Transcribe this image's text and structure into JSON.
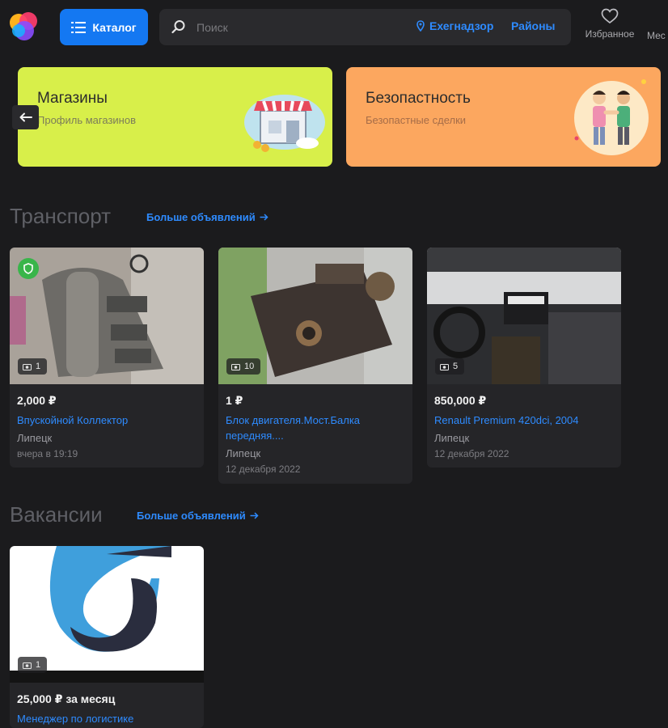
{
  "header": {
    "catalog_label": "Каталог",
    "search_placeholder": "Поиск",
    "location": "Ехегнадзор",
    "districts": "Районы",
    "favorites": "Избранное",
    "messages": "Мес"
  },
  "banners": [
    {
      "title": "Магазины",
      "subtitle": "Профиль магазинов"
    },
    {
      "title": "Безопастность",
      "subtitle": "Безопастные сделки"
    }
  ],
  "transport": {
    "title": "Транспорт",
    "more": "Больше объявлений",
    "cards": [
      {
        "photos": "1",
        "price": "2,000 ₽",
        "title": "Впускойной Коллектор",
        "city": "Липецк",
        "date": "вчера в 19:19",
        "verified": true
      },
      {
        "photos": "10",
        "price": "1 ₽",
        "title": "Блок двигателя.Мост.Балка передняя....",
        "city": "Липецк",
        "date": "12 декабря 2022",
        "verified": false
      },
      {
        "photos": "5",
        "price": "850,000 ₽",
        "title": "Renault Premium 420dci, 2004",
        "city": "Липецк",
        "date": "12 декабря 2022",
        "verified": false
      }
    ]
  },
  "vacancies": {
    "title": "Вакансии",
    "more": "Больше объявлений",
    "cards": [
      {
        "photos": "1",
        "price": "25,000 ₽ за месяц",
        "title": "Менеджер по логистике"
      }
    ]
  },
  "colors": {
    "accent": "#1478f2",
    "link": "#2e8bff",
    "background": "#1b1b1d",
    "banner_shops": "#d8ef4a",
    "banner_safety": "#fca75f"
  }
}
